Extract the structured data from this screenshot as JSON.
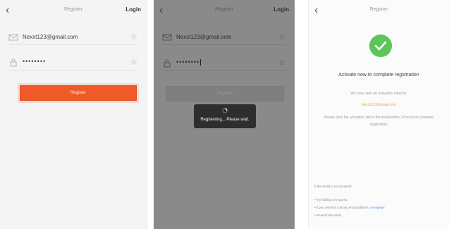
{
  "colors": {
    "accent": "#f05a28",
    "success": "#5cc65a",
    "link": "#4a90e2",
    "email_highlight": "#f3a53c"
  },
  "screens": [
    {
      "back_icon": "chevron-left-icon",
      "title": "Register",
      "login_label": "Login",
      "email_value": "Nexxt123@gmail.com",
      "password_value": "••••••••",
      "register_label": "Register"
    },
    {
      "back_icon": "chevron-left-icon",
      "title": "Register",
      "login_label": "Login",
      "email_value": "Nexxt123@gmail.com",
      "password_value": "••••••••",
      "register_label": "Register",
      "loading_text": "Registering... Please wait."
    },
    {
      "back_icon": "chevron-left-icon",
      "title": "Register",
      "heading": "Activate now to complete registration",
      "sent_text": "We have sent an activation email to:",
      "email": "Nexxt123@gmail.com",
      "instructions": "Please click the activation link in the email within 24 hours to complete registration.",
      "faq_heading": "If the email is not received:",
      "faq_try": "• Try finding it in spams.",
      "faq_wrong_prefix": "• If you entered a wrong email address,",
      "faq_register_link": "re-register",
      "faq_resend": "• Resend the email"
    }
  ]
}
